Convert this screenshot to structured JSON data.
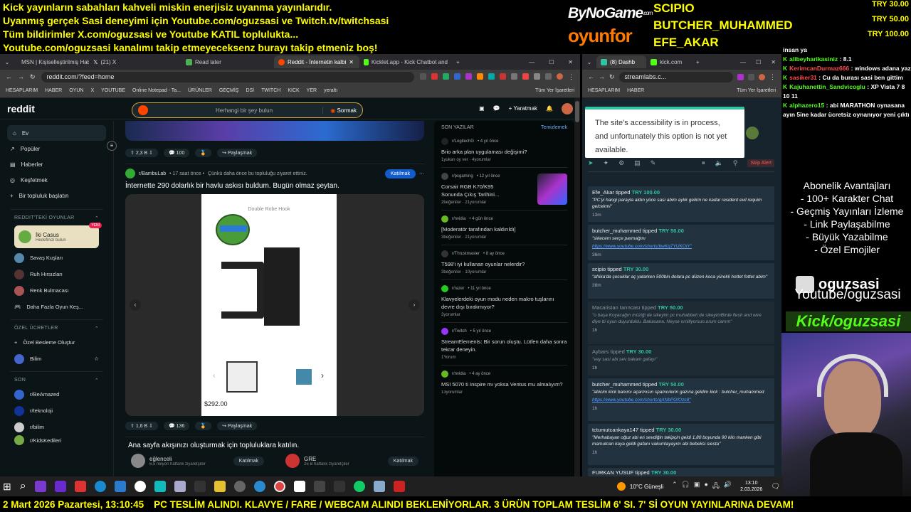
{
  "banner": {
    "line1": "Kick yayınların sabahları kahveli miskin enerjisiz uyanma yayınlarıdır.",
    "line2": "Uyanmış gerçek Sasi deneyimi için Youtube.com/oguzsasi ve Twitch.tv/twitchsasi",
    "line3": "Tüm bildirimler X.com/oguzsasi ve Youtube KATIL toplulukta...",
    "line4": "Youtube.com/oguzsasi kanalımı takip etmeyeceksenz burayı takip etmeniz boş!"
  },
  "donations": {
    "logo1": "ByNoGame",
    "logo1_suffix": ".com",
    "logo2": "oyunfor",
    "names": [
      "SCIPIO",
      "BUTCHER_MUHAMMED",
      "EFE_AKAR"
    ],
    "amounts": [
      "TRY 30.00",
      "TRY 50.00",
      "TRY 100.00"
    ]
  },
  "left_browser": {
    "tabs": [
      "MSN | Kişiselleştirilmiş Haberle",
      "(21) X",
      "Read later",
      "Reddit - İnternetin kalbi",
      "Kicklet.app - Kick Chatbot and"
    ],
    "url": "reddit.com/?feed=home",
    "bookmarks": [
      "HESAPLARIM",
      "HABER",
      "OYUN",
      "X",
      "YOUTUBE",
      "Online Notepad - Ta...",
      "ÜRÜNLER",
      "GEÇMİŞ",
      "DSİ",
      "TWITCH",
      "KICK",
      "YER",
      "yeraltı",
      "Tüm Yer İşaretleri"
    ]
  },
  "reddit": {
    "logo": "reddit",
    "search_placeholder": "Herhangi bir şey bulun",
    "ask": "Sormak",
    "create": "Yaratmak",
    "nav": [
      "Ev",
      "Popüler",
      "Haberler",
      "Keşfetmek",
      "Bir topluluk başlatın"
    ],
    "games_header": "REDDIT'TEKİ OYUNLAR",
    "games": [
      {
        "name": "İki Casus",
        "sub": "Hedefinizi bulun",
        "badge": "YENİ"
      },
      {
        "name": "Savaş Kuşları"
      },
      {
        "name": "Ruh Hırsızları"
      },
      {
        "name": "Renk Bulmacası"
      },
      {
        "name": "Daha Fazla Oyun Keş..."
      }
    ],
    "custom_header": "ÖZEL ÜCRETLER",
    "custom": [
      "Özel Besleme Oluştur",
      "Bilim"
    ],
    "recent_header": "SON",
    "recent": [
      "r/BeAmazed",
      "r/teknoloji",
      "r/bilim",
      "r/KidsKedileri"
    ],
    "post1_stats": {
      "votes": "2,3 B",
      "comments": "100",
      "share": "Paylaşmak"
    },
    "post2": {
      "sub": "r/BambuLab",
      "time": "• 17 saat önce •",
      "reason": "Çünkü daha önce bu topluluğu ziyaret ettiniz.",
      "join": "Katılmak",
      "title": "İnternette 290 dolarlık bir havlu askısı buldum. Bugün olmaz şeytan.",
      "product": "Double Robe Hook",
      "price": "$292.00",
      "votes": "1,6 B",
      "comments": "136",
      "share": "Paylaşmak"
    },
    "prompt": "Ana sayfa akışınızı oluşturmak için topluluklara katılın.",
    "suggest": [
      {
        "name": "eğlenceli",
        "meta": "6,5 milyon haftalık ziyaretçiler",
        "join": "Katılmak"
      },
      {
        "name": "GRE",
        "meta": "25 B haftalık ziyaretçiler",
        "join": "Katılmak"
      }
    ],
    "recent_panel": {
      "title": "SON YAZILAR",
      "clear": "Temizlemek",
      "items": [
        {
          "sub": "r/LogitechG",
          "time": "• 4 yıl önce",
          "title": "Brio arka plan uygulaması değişimi?",
          "meta": "1yukarı oy ver · 4yorumlar"
        },
        {
          "sub": "r/pcgaming",
          "time": "• 12 yıl önce",
          "title": "Corsair RGB K70/K95 Sonunda Çıkış Tarihini...",
          "meta": "2beğeniler · 21yorumlar"
        },
        {
          "sub": "r/nvidia",
          "time": "• 4 gün önce",
          "title": "[Moderatör tarafından kaldırıldı]",
          "meta": "3beğeniler · 21yorumlar"
        },
        {
          "sub": "r/Thrustmaster",
          "time": "• 8 ay önce",
          "title": "T598'i iyi kullanan oyunlar nelerdir?",
          "meta": "3beğeniler · 10yorumlar"
        },
        {
          "sub": "r/razer",
          "time": "• 11 yıl önce",
          "title": "Klavyelerdeki oyun modu neden makro tuşlarını devre dışı bırakmıyor?",
          "meta": "3yorumlar"
        },
        {
          "sub": "r/Twitch",
          "time": "• 5 yıl önce",
          "title": "StreamElements: Bir sorun oluştu. Lütfen daha sonra tekrar deneyin.",
          "meta": "1Yorum"
        },
        {
          "sub": "r/nvidia",
          "time": "• 4 ay önce",
          "title": "MSI 5070 ti Inspire mı yoksa Ventus mu almalıyım?",
          "meta": "13yorumlar"
        }
      ]
    }
  },
  "right_browser": {
    "tabs": [
      "(8) Dashb",
      "kick.com"
    ],
    "url": "streamlabs.c...",
    "bookmarks": [
      "HESAPLARIM",
      "HABER",
      "Tüm Yer İşaretleri"
    ],
    "tooltip": "The site's accessibility is in process, and unfortunately this option is not yet available.",
    "skip_alert": "Skip Alert",
    "alerts": [
      {
        "name": "Efe_Akar",
        "verb": "tipped",
        "amount": "TRY 100.00",
        "msg": "\"PC'yi hangi parayla aldın yüce sasi abim aylık gelirin ne kadar resident evil requim gelcekmi\"",
        "ago": "13m"
      },
      {
        "name": "butcher_muhammed",
        "verb": "tipped",
        "amount": "TRY 50.00",
        "msg": "\"sikecem serçe parmağını",
        "link": "https://www.youtube.com/shorts/bwKq7YUKOiY\"",
        "ago": "36m"
      },
      {
        "name": "scipio",
        "verb": "tipped",
        "amount": "TRY 30.00",
        "msg": "\"afrika'da çocuklar aç yatarken 500bin dolara pc düzen koca yürekli hottet fottet abim\"",
        "ago": "38m"
      },
      {
        "name": "Macaristan tarıncası",
        "verb": "tipped",
        "amount": "TRY 50.00",
        "msg": "\"o başa Koyacağın müziği de sikeyim pc muhabbeti de sikeyimBirde flesh and wire diye bi oyun duyurduklu. Bakasana. Neyse ornillyorsun.orum canım\"",
        "ago": "1h",
        "dim": true
      },
      {
        "name": "Aybars",
        "verb": "tipped",
        "amount": "TRY 30.00",
        "msg": "\"vay sasi abi sev bakam gafayı\"",
        "ago": "1h",
        "dim": true
      },
      {
        "name": "butcher_muhammed",
        "verb": "tipped",
        "amount": "TRY 50.00",
        "msg": "\"abicim kick banımı açarmısın spamcılerin gazına geldim kick : butcher_muhammed",
        "link": "https://www.youtube.com/shorts/qANbPGfOzc8\"",
        "ago": "1h"
      },
      {
        "name": "tctumutcankaya147",
        "verb": "tipped",
        "amount": "TRY 30.00",
        "msg": "\"Merhabayan oğuz abi en sevdiğin takipçin geldi 1,80 boyunda 90 kilo manken gibi mamutcan kaya geldi gafanı vakumlayayım abi bebeksi siesta\"",
        "ago": "1h"
      },
      {
        "name": "FURKAN YUSUF",
        "verb": "tipped",
        "amount": "TRY 30.00",
        "msg": "",
        "ago": ""
      }
    ]
  },
  "chat": {
    "lines": [
      {
        "user": "",
        "text": "insan ya"
      },
      {
        "user": "alibeyharikasiniz",
        "text": ": 8.1"
      },
      {
        "user": "KerimcanDurmaz666",
        "text": ": windows adana yaz",
        "red": true
      },
      {
        "user": "sasiker31",
        "text": ": Cu da burası sasi ben gittim",
        "red": true
      },
      {
        "user": "Kajuhanettin_Sandvicoglu",
        "text": ": XP Vista 7 8 10 11"
      },
      {
        "user": "alphazero15",
        "text": ": abi MARATHON oynasana ayın 5ine kadar ücretsiz oynanıyor yeni çıktı"
      }
    ]
  },
  "subscription": {
    "title": "Abonelik Avantajları",
    "items": [
      "- 100+ Karakter Chat",
      "- Geçmiş Yayınları İzleme",
      "- Link Paylaşabilme",
      "- Büyük Yazabilme",
      "- Özel Emojiler"
    ]
  },
  "social": {
    "brand": "oguzsasi",
    "youtube": "Youtube/oguzsasi",
    "kick": "Kick/oguzsasi"
  },
  "taskbar": {
    "weather": "10°C Güneşli",
    "time": "13:10",
    "date": "2.03.2026"
  },
  "ticker": {
    "date": "2 Mart 2026 Pazartesi, 13:10:45",
    "text": "PC TESLİM ALINDI. KLAVYE / FARE / WEBCAM ALINDI BEKLENİYORLAR. 3 ÜRÜN TOPLAM TESLİM 6' SI. 7' Sİ OYUN YAYINLARINA DEVAM!"
  },
  "colors": {
    "accent": "#ffff00",
    "kick": "#53fc18",
    "streamlabs": "#31c3a2",
    "reddit_join": "#115bca"
  }
}
